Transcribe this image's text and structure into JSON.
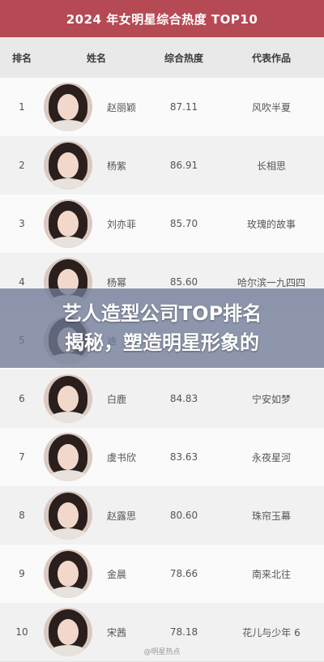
{
  "title": "2024 年女明星综合热度 TOP10",
  "columns": {
    "rank": "排名",
    "name": "姓名",
    "heat": "综合热度",
    "works": "代表作品"
  },
  "rows": [
    {
      "rank": "1",
      "name": "赵丽颖",
      "heat": "87.11",
      "work": "风吹半夏"
    },
    {
      "rank": "2",
      "name": "杨紫",
      "heat": "86.91",
      "work": "长相思"
    },
    {
      "rank": "3",
      "name": "刘亦菲",
      "heat": "85.70",
      "work": "玫瑰的故事"
    },
    {
      "rank": "4",
      "name": "杨幂",
      "heat": "85.60",
      "work": "哈尔滨一九四四"
    },
    {
      "rank": "5",
      "name": "迪",
      "heat": "",
      "work": ""
    },
    {
      "rank": "6",
      "name": "白鹿",
      "heat": "84.83",
      "work": "宁安如梦"
    },
    {
      "rank": "7",
      "name": "虞书欣",
      "heat": "83.63",
      "work": "永夜星河"
    },
    {
      "rank": "8",
      "name": "赵露思",
      "heat": "80.60",
      "work": "珠帘玉幕"
    },
    {
      "rank": "9",
      "name": "金晨",
      "heat": "78.66",
      "work": "南来北往"
    },
    {
      "rank": "10",
      "name": "宋茜",
      "heat": "78.18",
      "work": "花儿与少年 6"
    }
  ],
  "overlay": {
    "line1": "艺人造型公司TOP排名",
    "line2": "揭秘，塑造明星形象的"
  },
  "watermark": "@明星热点",
  "colors": {
    "title_bg": "#b54a54",
    "overlay_bg": "#6e7a96"
  }
}
